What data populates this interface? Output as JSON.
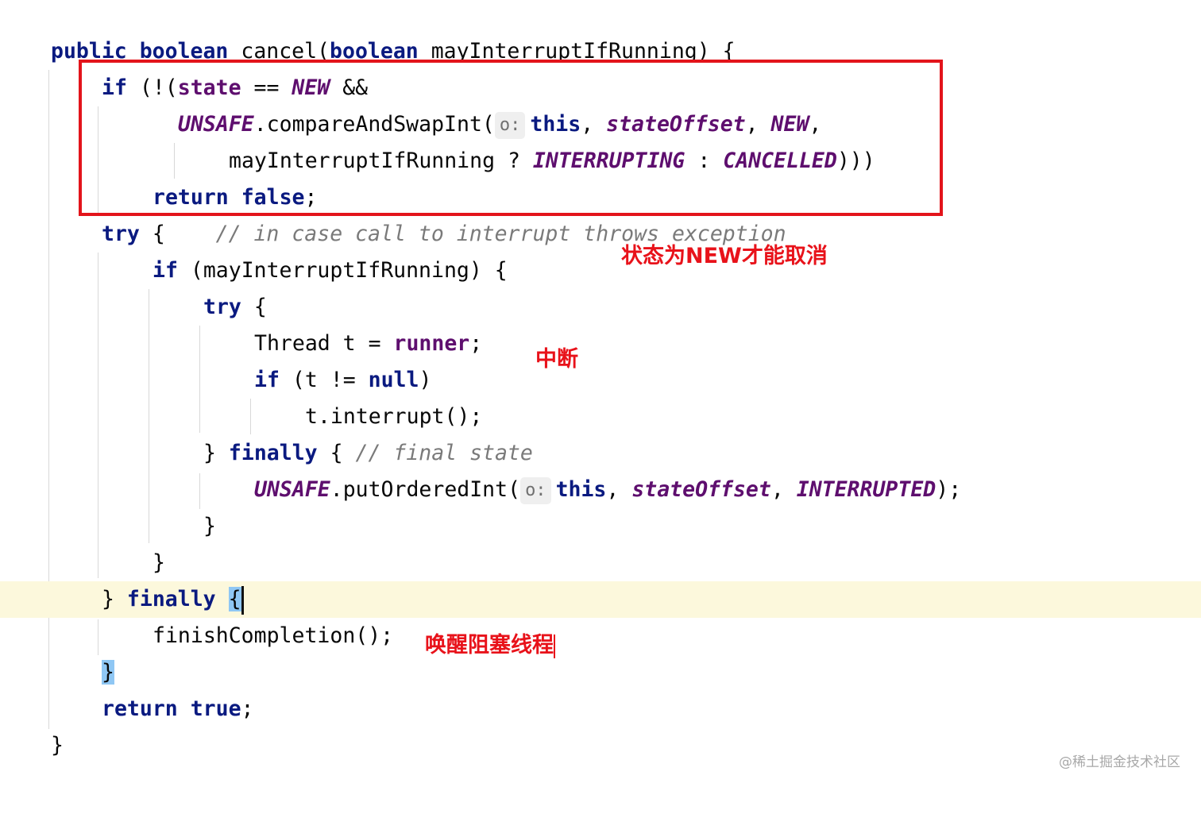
{
  "code": {
    "l1": {
      "kw1": "public",
      "kw2": "boolean",
      "name": "cancel(",
      "kw3": "boolean",
      "rest": " mayInterruptIfRunning) {"
    },
    "l2": {
      "kw": "if",
      "p1": " (!(",
      "field": "state",
      "p2": " == ",
      "const": "NEW",
      "p3": " &&"
    },
    "l3": {
      "const1": "UNSAFE",
      "p1": ".compareAndSwapInt(",
      "hint": "o:",
      "kw": "this",
      "p2": ", ",
      "const2": "stateOffset",
      "p3": ", ",
      "const3": "NEW",
      "p4": ","
    },
    "l4": {
      "p1": "mayInterruptIfRunning ? ",
      "const1": "INTERRUPTING",
      "p2": " : ",
      "const2": "CANCELLED",
      "p3": ")))"
    },
    "l5": {
      "kw1": "return",
      "kw2": "false",
      "p1": ";"
    },
    "l6": {
      "kw": "try",
      "p1": " {    ",
      "comment": "// in case call to interrupt throws exception"
    },
    "l7": {
      "kw": "if",
      "p1": " (mayInterruptIfRunning) {"
    },
    "l8": {
      "kw": "try",
      "p1": " {"
    },
    "l9": {
      "p1": "Thread t = ",
      "field": "runner",
      "p2": ";"
    },
    "l10": {
      "kw1": "if",
      "p1": " (t != ",
      "kw2": "null",
      "p2": ")"
    },
    "l11": {
      "p1": "t.interrupt();"
    },
    "l12": {
      "p1": "} ",
      "kw": "finally",
      "p2": " { ",
      "comment": "// final state"
    },
    "l13": {
      "const1": "UNSAFE",
      "p1": ".putOrderedInt(",
      "hint": "o:",
      "kw": "this",
      "p2": ", ",
      "const2": "stateOffset",
      "p3": ", ",
      "const3": "INTERRUPTED",
      "p4": ");"
    },
    "l14": {
      "p1": "}"
    },
    "l15": {
      "p1": "}"
    },
    "l16": {
      "p1": "} ",
      "kw": "finally",
      "p2": " ",
      "brace": "{"
    },
    "l17": {
      "p1": "finishCompletion();"
    },
    "l18": {
      "brace": "}"
    },
    "l19": {
      "kw1": "return",
      "kw2": "true",
      "p1": ";"
    },
    "l20": {
      "p1": "}"
    }
  },
  "annotations": {
    "state_new_only": "状态为NEW才能取消",
    "interrupt": "中断",
    "wake_blocked": "唤醒阻塞线程"
  },
  "watermark": "@稀土掘金技术社区",
  "colors": {
    "keyword": "#0a1a80",
    "field": "#5e0e6e",
    "comment": "#7a7a7a",
    "annotation_red": "#e8121a",
    "caret_row": "#fcf8dc",
    "brace_match": "#8fc7f4"
  }
}
